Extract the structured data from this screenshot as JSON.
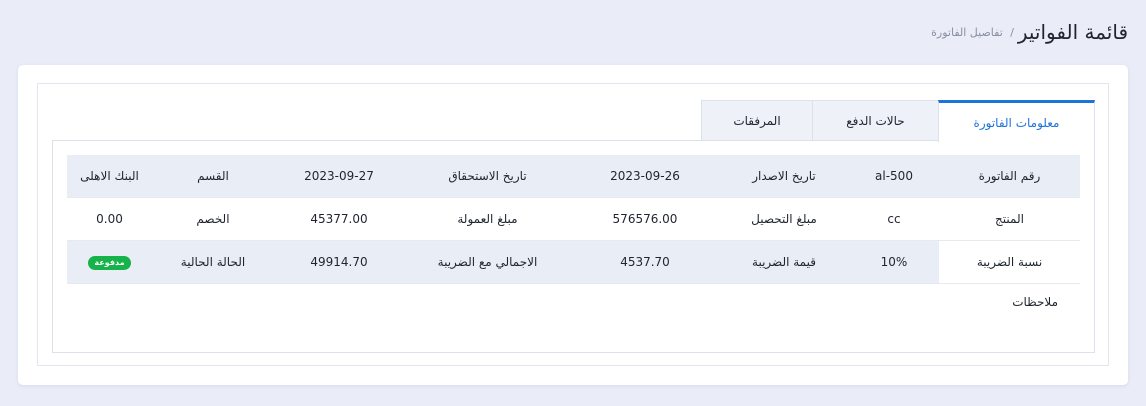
{
  "header": {
    "title": "قائمة الفواتير",
    "breadcrumb_separator": "/",
    "breadcrumb_current": "تفاصيل الفاتورة"
  },
  "tabs": [
    {
      "label": "معلومات الفاتورة",
      "active": true
    },
    {
      "label": "حالات الدفع",
      "active": false
    },
    {
      "label": "المرفقات",
      "active": false
    }
  ],
  "invoice_table": {
    "rows": [
      [
        "رقم الفاتورة",
        "al-500",
        "تاريخ الاصدار",
        "2023-09-26",
        "تاريخ الاستحقاق",
        "2023-09-27",
        "القسم",
        "البنك الاهلى"
      ],
      [
        "المنتج",
        "cc",
        "مبلغ التحصيل",
        "576576.00",
        "مبلغ العمولة",
        "45377.00",
        "الخصم",
        "0.00"
      ],
      [
        "نسبة الضريبة",
        "10%",
        "قيمة الضريبة",
        "4537.70",
        "الاجمالي مع الضريبة",
        "49914.70",
        "الحالة الحالية",
        "مدفوعة"
      ]
    ]
  },
  "notes_label": "ملاحظات",
  "colors": {
    "accent": "#1e73d8",
    "paid_badge": "#16b34a",
    "row_shade": "#e9edf6",
    "background": "#eaedf7"
  }
}
